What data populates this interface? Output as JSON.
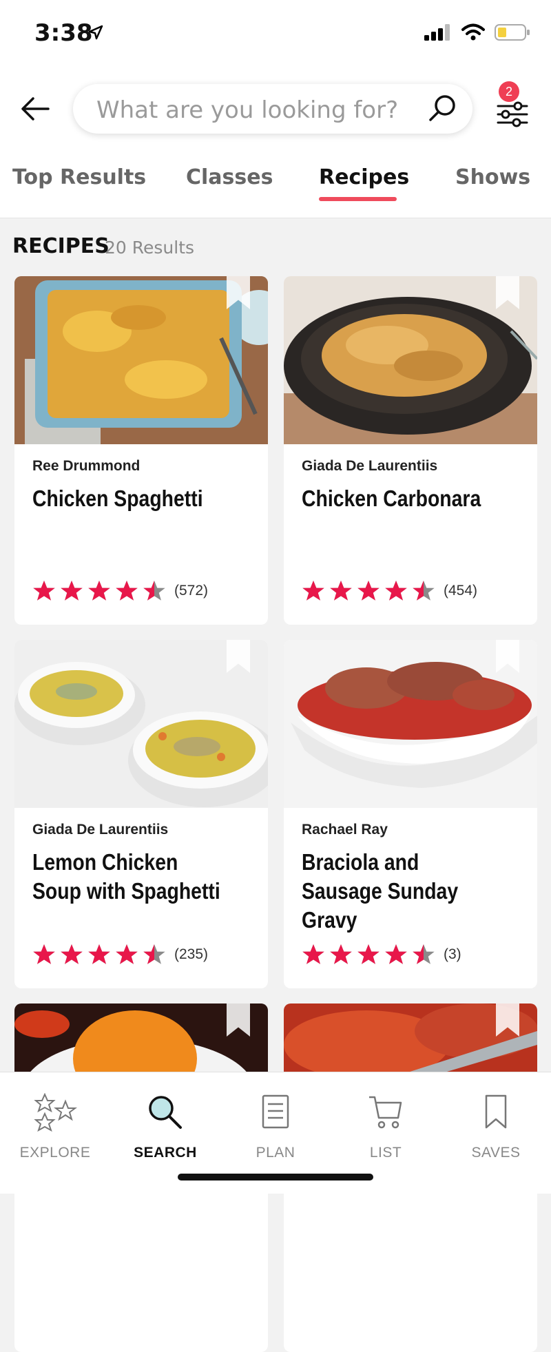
{
  "status": {
    "time": "3:38"
  },
  "search": {
    "placeholder": "What are you looking for?",
    "filter_count": "2"
  },
  "tabs": [
    {
      "label": "Top Results",
      "active": false
    },
    {
      "label": "Classes",
      "active": false
    },
    {
      "label": "Recipes",
      "active": true
    },
    {
      "label": "Shows",
      "active": false
    }
  ],
  "section": {
    "title": "RECIPES",
    "count": "20 Results"
  },
  "recipes": [
    {
      "author": "Ree Drummond",
      "title": "Chicken Spaghetti",
      "rating": 4.5,
      "count": "(572)"
    },
    {
      "author": "Giada De Laurentiis",
      "title": "Chicken Carbonara",
      "rating": 4.5,
      "count": "(454)"
    },
    {
      "author": "Giada De Laurentiis",
      "title": "Lemon Chicken Soup with Spaghetti",
      "rating": 4.5,
      "count": "(235)"
    },
    {
      "author": "Rachael Ray",
      "title": "Braciola and Sausage Sunday Gravy",
      "rating": 4.5,
      "count": "(3)"
    }
  ],
  "nav": [
    {
      "label": "EXPLORE",
      "icon": "stars-icon",
      "active": false
    },
    {
      "label": "SEARCH",
      "icon": "search-icon",
      "active": true
    },
    {
      "label": "PLAN",
      "icon": "document-icon",
      "active": false
    },
    {
      "label": "LIST",
      "icon": "cart-icon",
      "active": false
    },
    {
      "label": "SAVES",
      "icon": "bookmark-icon",
      "active": false
    }
  ],
  "colors": {
    "accent": "#ef4b5c",
    "star": "#e8174a",
    "badge": "#ef3e54"
  }
}
